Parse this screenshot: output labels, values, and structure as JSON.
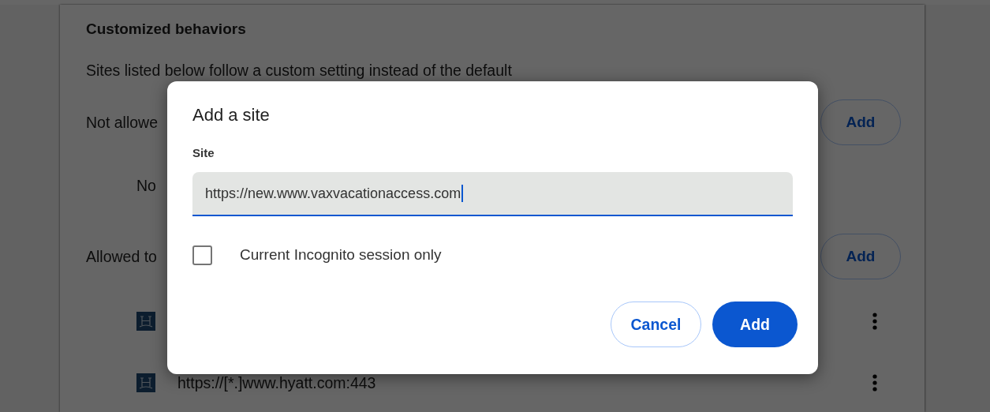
{
  "page": {
    "section_title": "Customized behaviors",
    "description": "Sites listed below follow a custom setting instead of the default",
    "not_allowed": {
      "label": "Not allowe",
      "add_button": "Add",
      "empty_text": "No"
    },
    "allowed": {
      "label": "Allowed to",
      "add_button": "Add",
      "sites": [
        {
          "kind": "covered"
        },
        {
          "kind": "url",
          "url": "https://[*.]www.hyatt.com:443"
        }
      ]
    }
  },
  "dialog": {
    "title": "Add a site",
    "field_label": "Site",
    "field_value": "https://new.www.vaxvacationaccess.com",
    "checkbox": {
      "label": "Current Incognito session only",
      "checked": false
    },
    "buttons": [
      {
        "label": "Cancel",
        "kind": "outlined"
      },
      {
        "label": "Add",
        "kind": "filled"
      }
    ]
  }
}
